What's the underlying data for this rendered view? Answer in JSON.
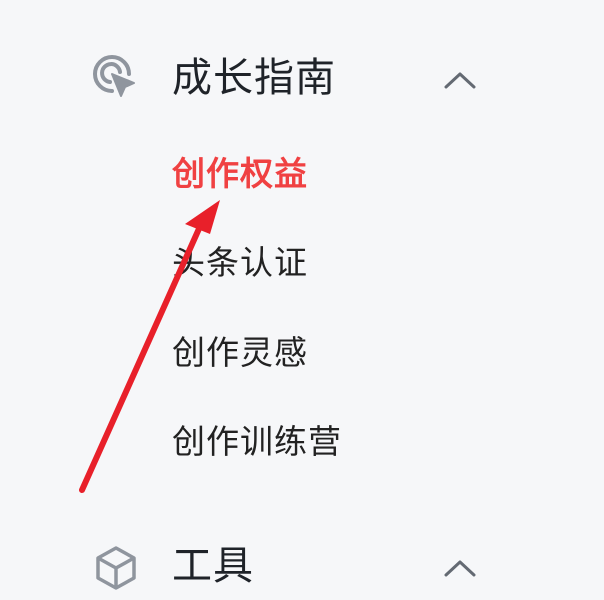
{
  "sections": [
    {
      "title": "成长指南",
      "icon": "cursor-click-icon",
      "expanded": true,
      "items": [
        {
          "label": "创作权益",
          "active": true
        },
        {
          "label": "头条认证",
          "active": false
        },
        {
          "label": "创作灵感",
          "active": false
        },
        {
          "label": "创作训练营",
          "active": false
        }
      ]
    },
    {
      "title": "工具",
      "icon": "cube-icon",
      "expanded": true,
      "items": []
    }
  ],
  "colors": {
    "active": "#f04142",
    "text": "#222222",
    "icon": "#8f959e",
    "background": "#f6f7f9",
    "annotation_arrow": "#e8202a"
  }
}
